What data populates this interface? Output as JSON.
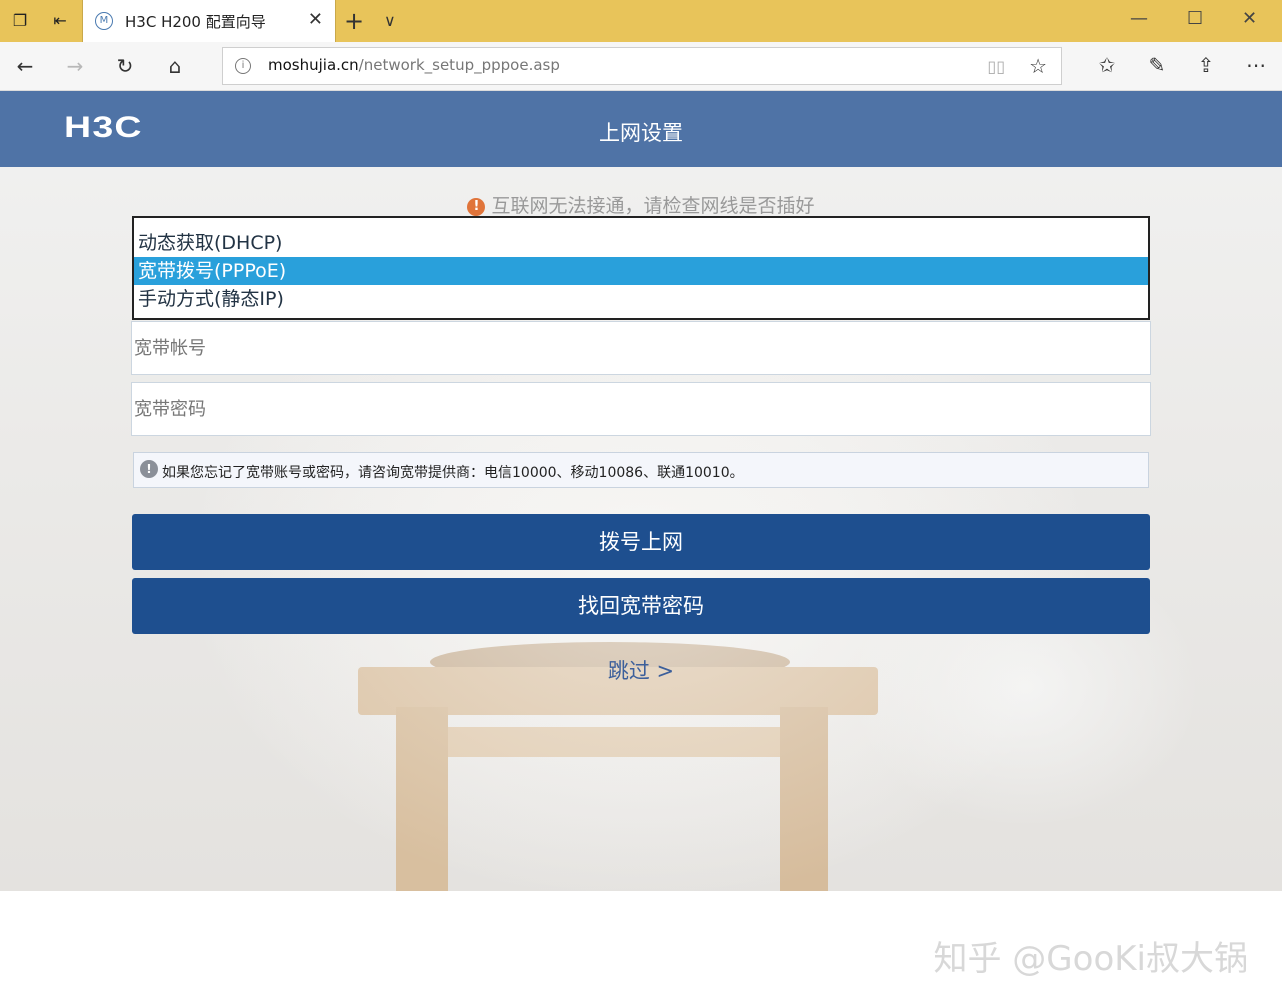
{
  "browser": {
    "tab_title": "H3C H200 配置向导",
    "tab_favicon": "M",
    "url_domain": "moshujia.cn",
    "url_path": "/network_setup_pppoe.asp"
  },
  "page": {
    "logo": "H3C",
    "title": "上网设置",
    "notice": "互联网无法接通，请检查网线是否插好",
    "connection_types": [
      "动态获取(DHCP)",
      "宽带拨号(PPPoE)",
      "手动方式(静态IP)"
    ],
    "selected_index": 1,
    "account_placeholder": "宽带帐号",
    "password_placeholder": "宽带密码",
    "tip": "如果您忘记了宽带账号或密码，请咨询宽带提供商：电信10000、移动10086、联通10010。",
    "dial_button": "拨号上网",
    "recover_button": "找回宽带密码",
    "skip_link": "跳过 >"
  },
  "watermark": "知乎 @GooKi叔大锅",
  "colors": {
    "header": "#4f73a6",
    "button": "#1e4f8f",
    "selected_option": "#29a0db",
    "tab_bar": "#e8c45a"
  }
}
